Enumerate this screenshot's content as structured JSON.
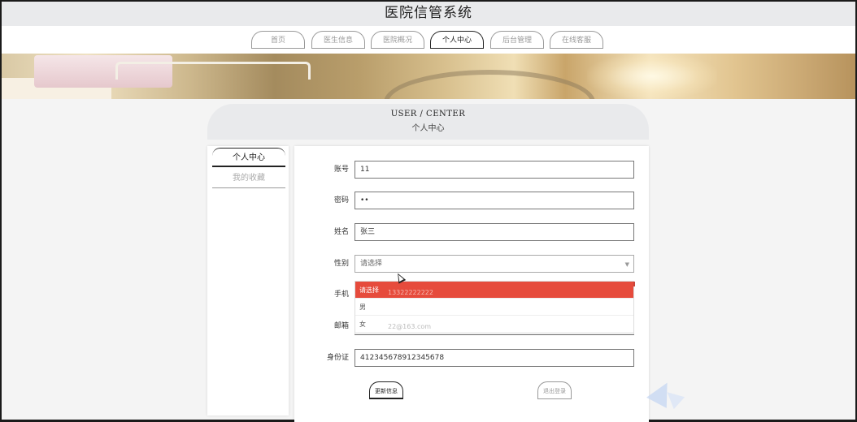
{
  "site": {
    "title": "医院信管系统"
  },
  "nav": {
    "items": [
      {
        "label": "首页",
        "active": false
      },
      {
        "label": "医生信息",
        "active": false
      },
      {
        "label": "医院概况",
        "active": false
      },
      {
        "label": "个人中心",
        "active": true
      },
      {
        "label": "后台管理",
        "active": false
      },
      {
        "label": "在线客服",
        "active": false
      }
    ]
  },
  "panel": {
    "title_en": "USER / CENTER",
    "title_cn": "个人中心"
  },
  "sidebar": {
    "items": [
      {
        "label": "个人中心",
        "active": true
      },
      {
        "label": "我的收藏",
        "active": false
      }
    ]
  },
  "form": {
    "account_label": "账号",
    "account_value": "11",
    "password_label": "密码",
    "password_value": "••",
    "name_label": "姓名",
    "name_value": "张三",
    "gender_label": "性别",
    "gender_value": "请选择",
    "phone_label": "手机",
    "phone_value": "13322222222",
    "email_label": "邮箱",
    "email_value": "22@163.com",
    "idcard_label": "身份证",
    "idcard_value": "412345678912345678"
  },
  "dropdown": {
    "options": [
      "请选择",
      "男",
      "女"
    ]
  },
  "buttons": {
    "update": "更新信息",
    "logout": "退出登录"
  },
  "colors": {
    "accent": "#e64b3c",
    "header_bg": "#e9eaec"
  }
}
